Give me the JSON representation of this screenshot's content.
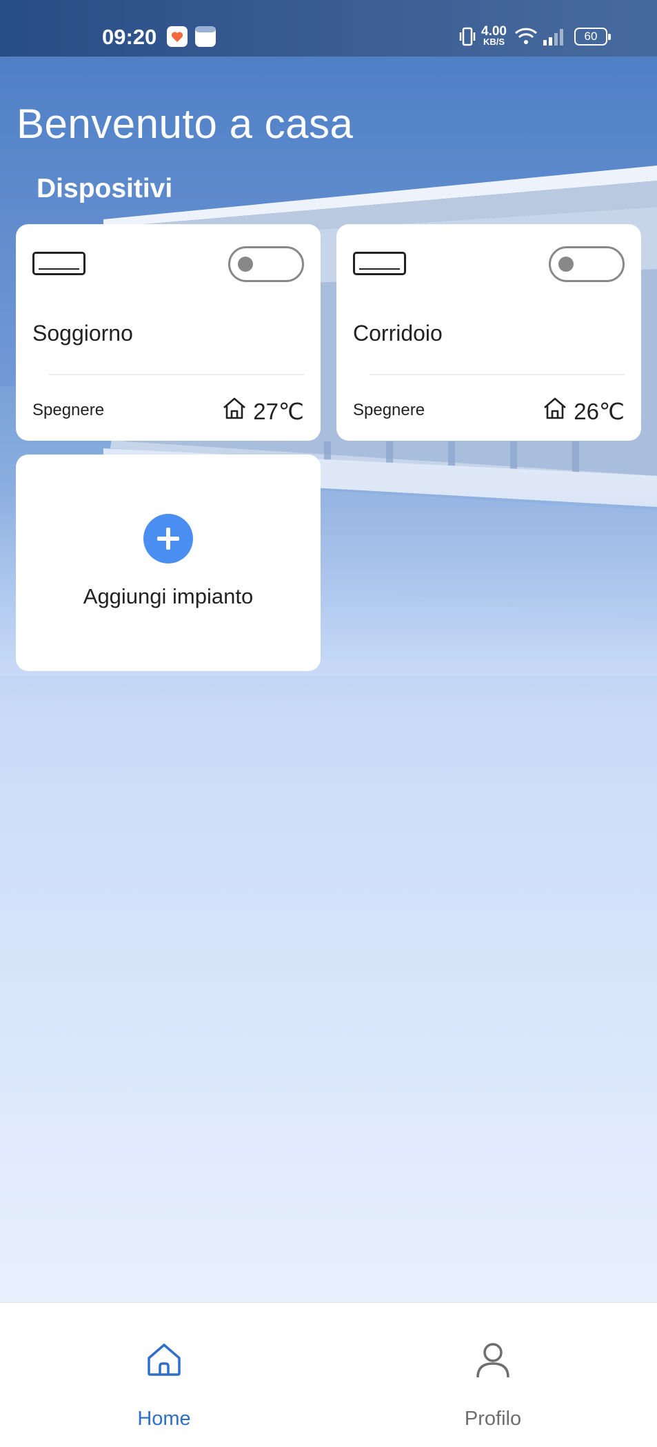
{
  "status_bar": {
    "time": "09:20",
    "net_speed_value": "4.00",
    "net_speed_unit": "KB/S",
    "battery": "60"
  },
  "header": {
    "title": "Benvenuto a casa",
    "section_title": "Dispositivi"
  },
  "devices": [
    {
      "name": "Soggiorno",
      "state": "Spegnere",
      "temperature": "27℃",
      "power_on": false,
      "icon": "air-conditioner-icon"
    },
    {
      "name": "Corridoio",
      "state": "Spegnere",
      "temperature": "26℃",
      "power_on": false,
      "icon": "air-conditioner-icon"
    }
  ],
  "add_device": {
    "label": "Aggiungi impianto",
    "icon": "plus-icon"
  },
  "bottom_nav": {
    "items": [
      {
        "label": "Home",
        "icon": "home-icon",
        "active": true
      },
      {
        "label": "Profilo",
        "icon": "person-icon",
        "active": false
      }
    ]
  },
  "colors": {
    "accent": "#4a8ef1",
    "nav_active": "#2f6fc8",
    "nav_inactive": "#6e6e6e"
  }
}
